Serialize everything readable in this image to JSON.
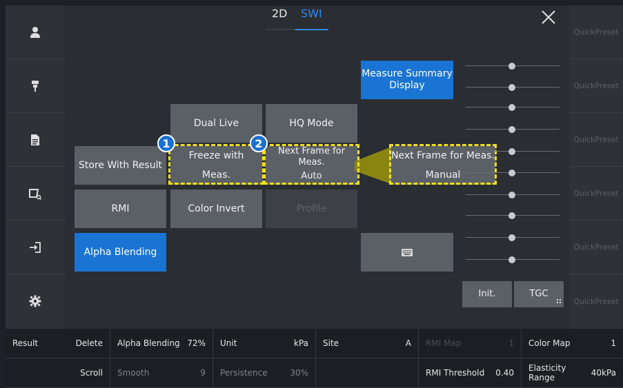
{
  "tabs": [
    {
      "label": "2D",
      "active": false
    },
    {
      "label": "SWI",
      "active": true
    }
  ],
  "sidebar": {
    "items": [
      {
        "icon": "user-icon"
      },
      {
        "icon": "probe-icon"
      },
      {
        "icon": "document-icon"
      },
      {
        "icon": "review-icon"
      },
      {
        "icon": "exit-icon"
      },
      {
        "icon": "gear-icon"
      }
    ]
  },
  "quick_presets": [
    "QuickPreset",
    "QuickPreset",
    "QuickPreset",
    "QuickPreset",
    "QuickPreset",
    "QuickPreset"
  ],
  "buttons": {
    "measure_summary_line1": "Measure Summary",
    "measure_summary_line2": "Display",
    "dual_live": "Dual Live",
    "hq_mode": "HQ Mode",
    "store_with_result": "Store With Result",
    "freeze_line1": "Freeze with",
    "freeze_line2": "Meas.",
    "next_frame_label": "Next Frame for Meas.",
    "next_frame_value": "Auto",
    "next_frame_zoom_label": "Next Frame for Meas.",
    "next_frame_zoom_value": "Manual",
    "rmi": "RMI",
    "color_invert": "Color Invert",
    "profile": "Profile",
    "alpha_blending": "Alpha Blending",
    "keyboard_icon": "keyboard-icon",
    "init": "Init.",
    "tgc": "TGC"
  },
  "badges": [
    "1",
    "2"
  ],
  "colors": {
    "accent_blue": "#1a74d4",
    "highlight_yellow": "#f2e11a",
    "callout_olive": "#8a8510"
  },
  "bottom_bar": {
    "row1": [
      {
        "label": "Result",
        "value": "Delete"
      },
      {
        "label": "Alpha Blending",
        "value": "72%"
      },
      {
        "label": "Unit",
        "value": "kPa"
      },
      {
        "label": "Site",
        "value": "A"
      },
      {
        "label": "RMI Map",
        "value": "1",
        "disabled": true
      },
      {
        "label": "Color Map",
        "value": "1"
      }
    ],
    "row2": [
      {
        "label": "",
        "value": "Scroll"
      },
      {
        "label": "Smooth",
        "value": "9",
        "disabled": true
      },
      {
        "label": "Persistence",
        "value": "30%",
        "disabled": true
      },
      {
        "label": "",
        "value": ""
      },
      {
        "label": "RMI Threshold",
        "value": "0.40"
      },
      {
        "label": "Elasticity Range",
        "value": "40kPa"
      }
    ]
  }
}
